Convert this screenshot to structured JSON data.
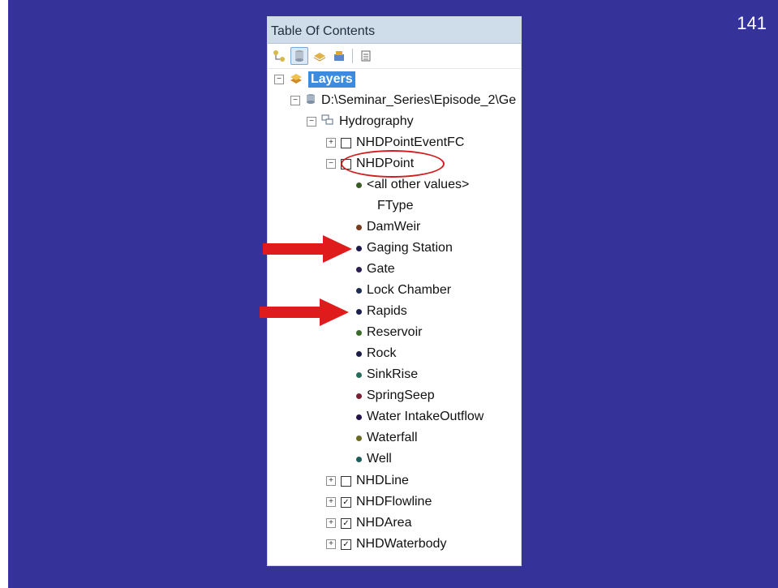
{
  "slide": {
    "page_number": "141",
    "background": "#35339a"
  },
  "toc": {
    "title": "Table Of Contents",
    "toolbar_icons": [
      "list-by-drawing-order-icon",
      "list-by-source-icon",
      "list-by-visibility-icon",
      "list-by-selection-icon",
      "options-icon"
    ],
    "layers_label": "Layers",
    "source_path": "D:\\Seminar_Series\\Episode_2\\Ge",
    "dataset": "Hydrography",
    "layers": {
      "pointEvent": "NHDPointEventFC",
      "point": "NHDPoint",
      "line": "NHDLine",
      "flowline": "NHDFlowline",
      "area": "NHDArea",
      "waterbody": "NHDWaterbody"
    },
    "legend_all_other": "<all other values>",
    "legend_field": "FType",
    "legend_items": [
      {
        "label": "DamWeir",
        "color": "#7a3a1e"
      },
      {
        "label": "Gaging Station",
        "color": "#1e1a4d"
      },
      {
        "label": "Gate",
        "color": "#2a1d4f"
      },
      {
        "label": "Lock Chamber",
        "color": "#1f2a4f"
      },
      {
        "label": "Rapids",
        "color": "#1a1f4d"
      },
      {
        "label": "Reservoir",
        "color": "#3b6a2a"
      },
      {
        "label": "Rock",
        "color": "#1b1d46"
      },
      {
        "label": "SinkRise",
        "color": "#2a6a5a"
      },
      {
        "label": "SpringSeep",
        "color": "#7a1f33"
      },
      {
        "label": "Water IntakeOutflow",
        "color": "#24124a"
      },
      {
        "label": "Waterfall",
        "color": "#6a6a22"
      },
      {
        "label": "Well",
        "color": "#1f5d5d"
      }
    ],
    "all_other_color": "#3a5a28"
  },
  "annotations": {
    "highlight_color": "#d21e1e"
  }
}
